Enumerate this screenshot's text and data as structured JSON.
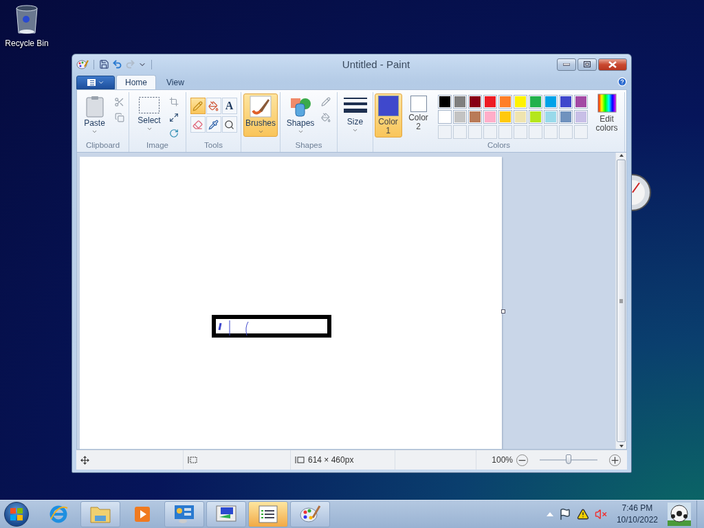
{
  "desktop": {
    "icons": [
      {
        "label": "Recycle Bin"
      }
    ]
  },
  "window": {
    "title": "Untitled - Paint"
  },
  "ribbon": {
    "tabs": [
      {
        "label": "Home",
        "selected": true
      },
      {
        "label": "View",
        "selected": false
      }
    ],
    "groups": [
      {
        "kind": "clipboard",
        "label": "Clipboard",
        "button": "Paste"
      },
      {
        "kind": "image",
        "label": "Image",
        "button": "Select"
      },
      {
        "kind": "tools",
        "label": "Tools",
        "tools": [
          {
            "kind": "pencil",
            "selected": true
          },
          {
            "kind": "fill",
            "selected": false
          },
          {
            "kind": "text",
            "glyph": "A",
            "selected": false
          },
          {
            "kind": "eraser",
            "selected": false
          },
          {
            "kind": "picker",
            "selected": false
          },
          {
            "kind": "magnifier",
            "selected": false
          }
        ]
      },
      {
        "kind": "brushes",
        "button": "Brushes",
        "selected": true
      },
      {
        "kind": "shapes",
        "label": "Shapes",
        "button": "Shapes"
      },
      {
        "kind": "size",
        "button": "Size"
      },
      {
        "kind": "colors",
        "label": "Colors",
        "slots": [
          {
            "label": "Color 1",
            "color": "#3f48cc",
            "selected": true
          },
          {
            "label": "Color 2",
            "color": "#ffffff",
            "selected": false
          }
        ],
        "palette": [
          {
            "color": "#000000"
          },
          {
            "color": "#7f7f7f"
          },
          {
            "color": "#880015"
          },
          {
            "color": "#ed1c24"
          },
          {
            "color": "#ff7f27"
          },
          {
            "color": "#fff200"
          },
          {
            "color": "#22b14c"
          },
          {
            "color": "#00a2e8"
          },
          {
            "color": "#3f48cc"
          },
          {
            "color": "#a349a4"
          },
          {
            "color": "#ffffff"
          },
          {
            "color": "#c3c3c3"
          },
          {
            "color": "#b97a57"
          },
          {
            "color": "#ffaec9"
          },
          {
            "color": "#ffc90e"
          },
          {
            "color": "#efe4b0"
          },
          {
            "color": "#b5e61d"
          },
          {
            "color": "#99d9ea"
          },
          {
            "color": "#7092be"
          },
          {
            "color": "#c8bfe7"
          },
          {
            "kind": "empty"
          },
          {
            "kind": "empty"
          },
          {
            "kind": "empty"
          },
          {
            "kind": "empty"
          },
          {
            "kind": "empty"
          },
          {
            "kind": "empty"
          },
          {
            "kind": "empty"
          },
          {
            "kind": "empty"
          },
          {
            "kind": "empty"
          },
          {
            "kind": "empty"
          }
        ],
        "edit": "Edit colors"
      }
    ]
  },
  "status_bar": {
    "canvas_size": "614 × 460px",
    "zoom": "100%",
    "zoom_slider": {
      "level": 0.5
    }
  },
  "taskbar": {
    "items": [
      {
        "kind": "browser",
        "running": false,
        "selected": false
      },
      {
        "kind": "folder",
        "running": true,
        "selected": false
      },
      {
        "kind": "media",
        "running": false,
        "selected": false
      },
      {
        "kind": "panel",
        "running": true,
        "selected": false
      },
      {
        "kind": "monitor",
        "running": true,
        "selected": false
      },
      {
        "kind": "list",
        "running": true,
        "selected": true
      },
      {
        "kind": "paint",
        "running": true,
        "selected": false
      }
    ],
    "clock": {
      "time": "7:46 PM",
      "date": "10/10/2022"
    }
  }
}
